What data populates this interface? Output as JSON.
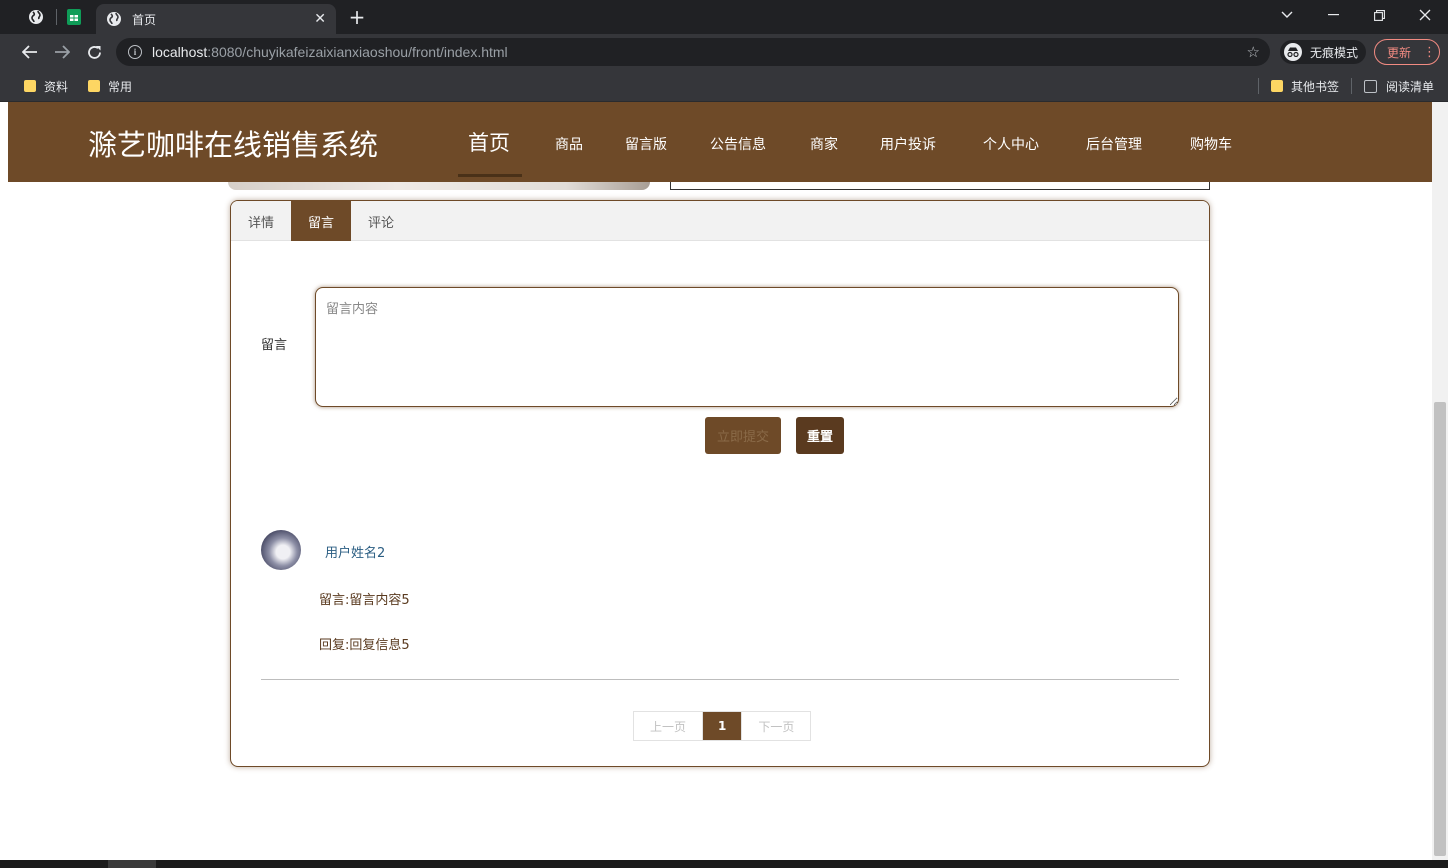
{
  "browser": {
    "active_tab_title": "首页",
    "url_host": "localhost",
    "url_rest": ":8080/chuyikafeizaixianxiaoshou/front/index.html",
    "incognito_label": "无痕模式",
    "update_label": "更新",
    "bookmarks": [
      {
        "label": "资料"
      },
      {
        "label": "常用"
      }
    ],
    "other_bookmarks_label": "其他书签",
    "reading_list_label": "阅读清单"
  },
  "site": {
    "title": "滁艺咖啡在线销售系统",
    "nav": [
      {
        "label": "首页",
        "active": true
      },
      {
        "label": "商品"
      },
      {
        "label": "留言版"
      },
      {
        "label": "公告信息"
      },
      {
        "label": "商家"
      },
      {
        "label": "用户投诉"
      },
      {
        "label": "个人中心"
      },
      {
        "label": "后台管理"
      },
      {
        "label": "购物车"
      }
    ]
  },
  "detail_tabs": [
    {
      "label": "详情"
    },
    {
      "label": "留言",
      "active": true
    },
    {
      "label": "评论"
    }
  ],
  "message_form": {
    "label": "留言",
    "placeholder": "留言内容",
    "submit_label": "立即提交",
    "reset_label": "重置"
  },
  "messages": [
    {
      "username": "用户姓名2",
      "content": "留言:留言内容5",
      "reply": "回复:回复信息5"
    }
  ],
  "pagination": {
    "prev_label": "上一页",
    "current_page": "1",
    "next_label": "下一页"
  },
  "colors": {
    "brand": "#6e4a28",
    "brand_dark": "#5a3a1f",
    "chrome_dark": "#202124",
    "chrome_toolbar": "#35363a"
  }
}
